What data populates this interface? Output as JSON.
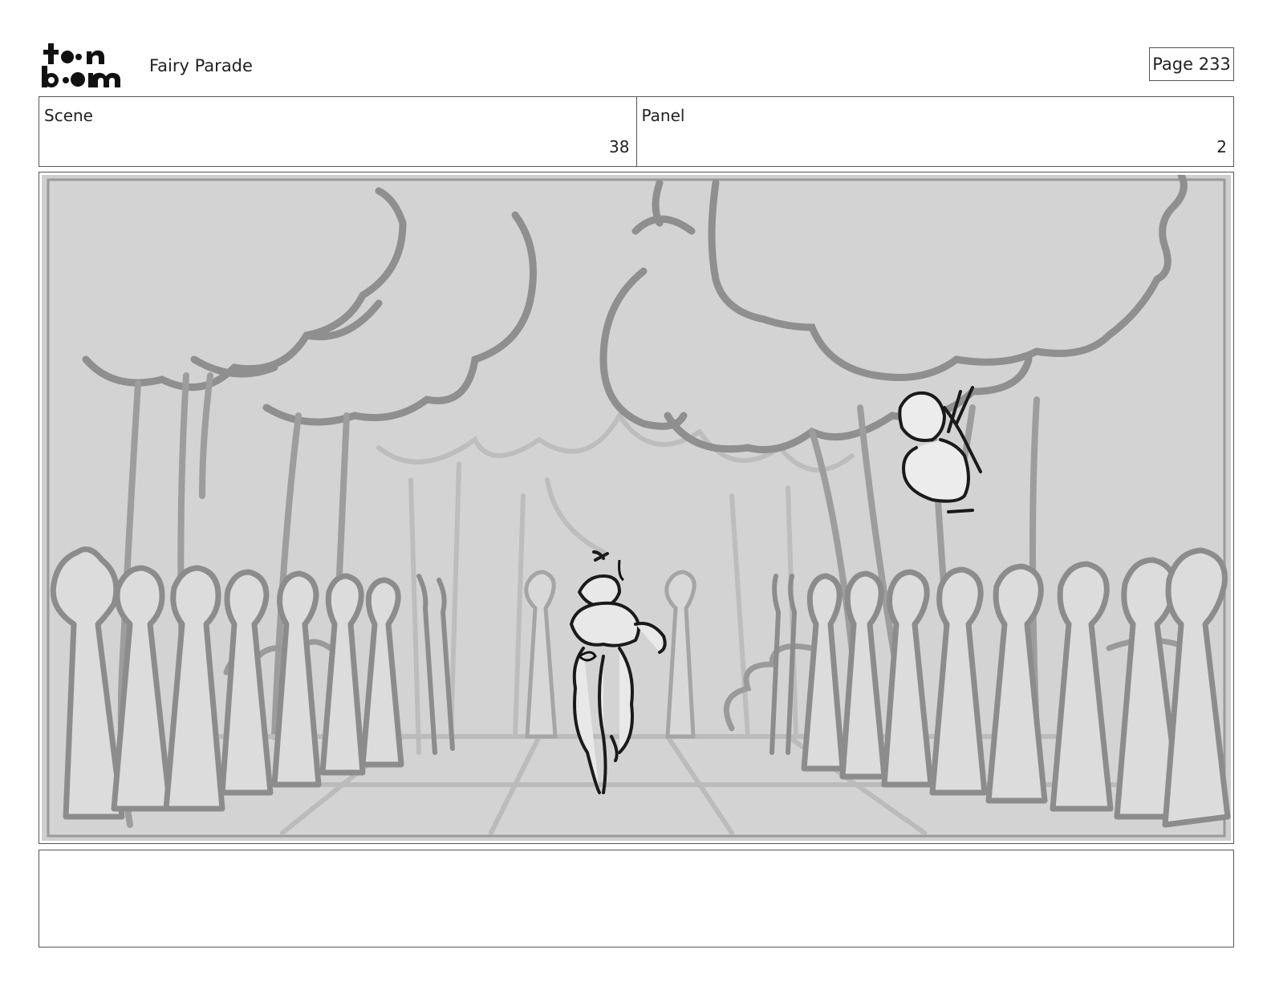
{
  "header": {
    "logo_top": "toon",
    "logo_bottom": "boom",
    "project_title": "Fairy Parade",
    "page_label": "Page 233"
  },
  "info": {
    "scene_label": "Scene",
    "scene_value": "38",
    "panel_label": "Panel",
    "panel_value": "2"
  },
  "panel_image": {
    "icon": "storyboard-sketch-forest-parade-icon"
  },
  "notes": {
    "text": ""
  }
}
